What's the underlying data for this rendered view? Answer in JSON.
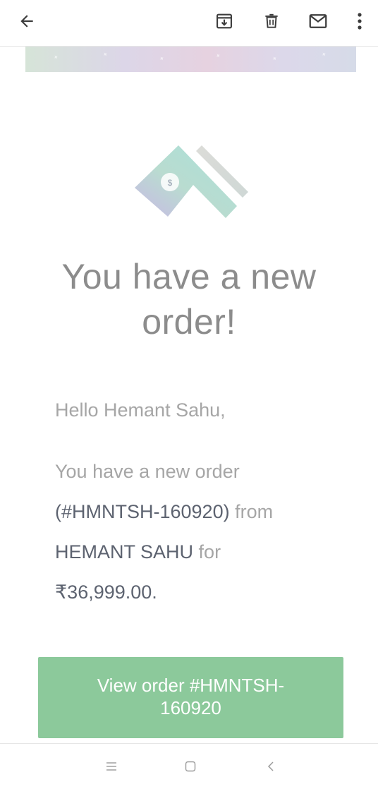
{
  "app_bar": {
    "icons": [
      "back-arrow-icon",
      "archive-icon",
      "delete-icon",
      "mail-icon",
      "more-vert-icon"
    ]
  },
  "email": {
    "headline_line1": "You have a new",
    "headline_line2": "order!",
    "greeting": "Hello Hemant Sahu,",
    "body_text_1": "You have a new order",
    "order_id": "(#HMNTSH-160920)",
    "body_text_2": "from",
    "customer_name": "HEMANT SAHU",
    "body_text_3": "for",
    "amount": "₹36,999.00.",
    "cta_line1": "View order #HMNTSH-",
    "cta_line2": "160920",
    "accent_color": "#8cc99b"
  },
  "nav_bar": {
    "icons": [
      "recents-icon",
      "home-icon",
      "back-icon"
    ]
  }
}
